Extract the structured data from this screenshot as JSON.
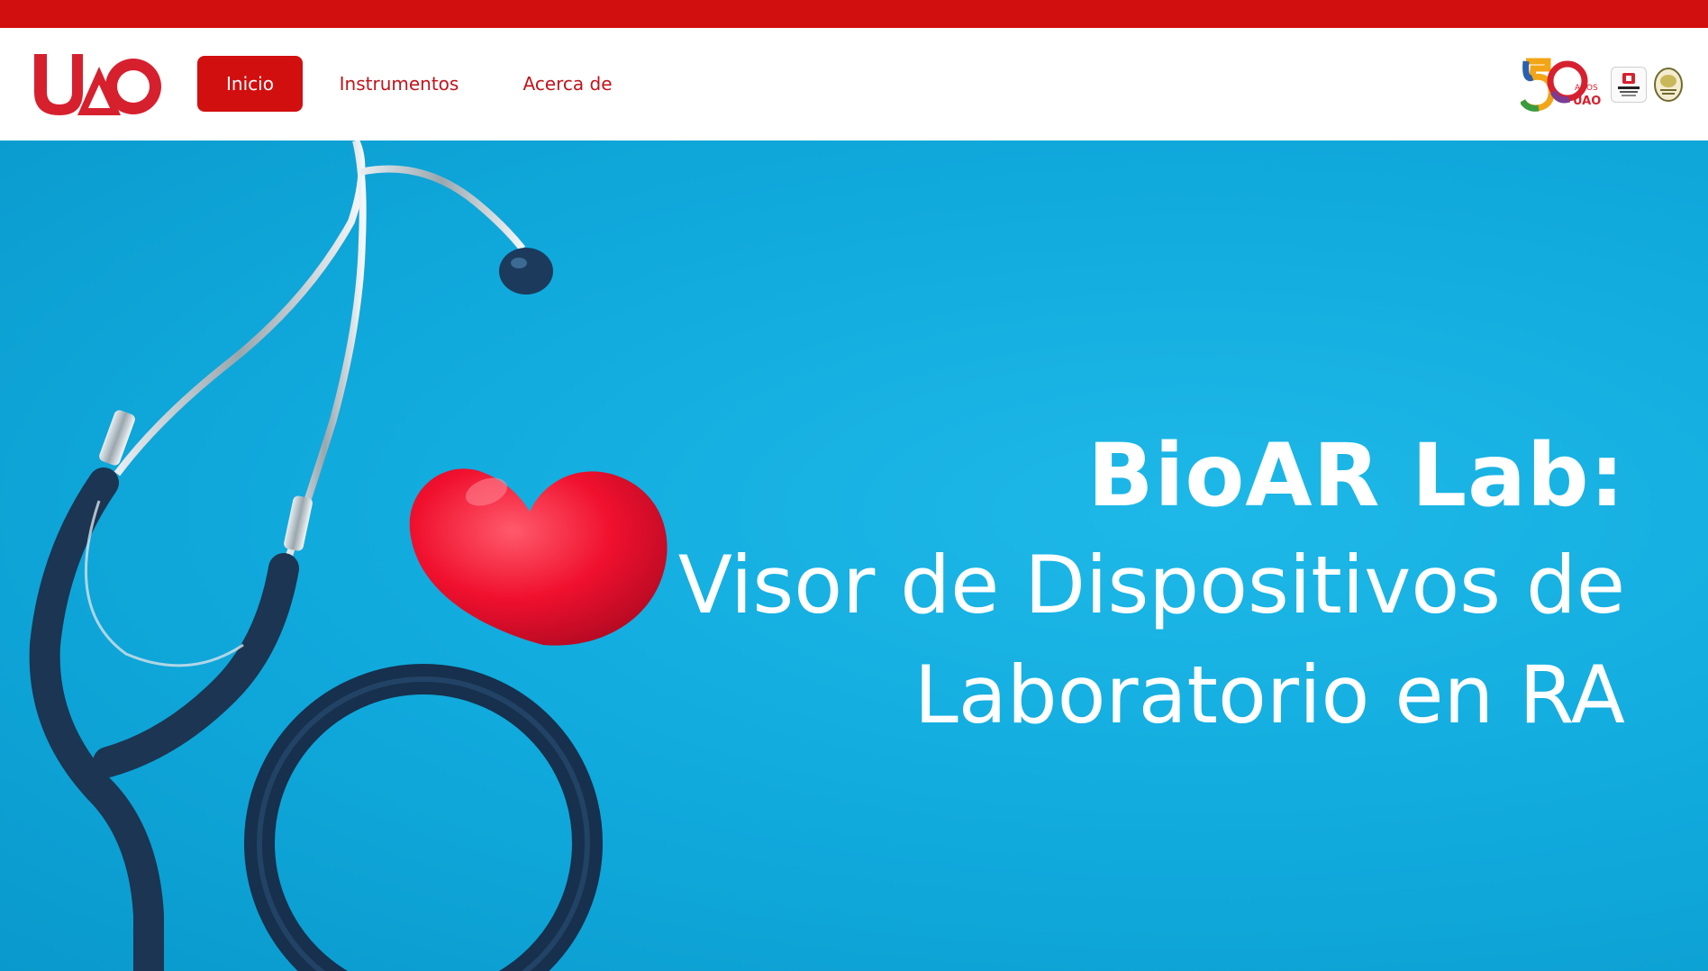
{
  "brand": {
    "logo_text": "UAO",
    "logo_color": "#d6202e"
  },
  "nav": {
    "items": [
      {
        "label": "Inicio",
        "active": true
      },
      {
        "label": "Instrumentos",
        "active": false
      },
      {
        "label": "Acerca de",
        "active": false
      }
    ],
    "accent_color": "#d20f0f"
  },
  "partners": {
    "anniversary_number": "50",
    "anniversary_text": "AÑOS",
    "anniversary_brand": "UAO",
    "seal_text": "AUTÓNOMA"
  },
  "hero": {
    "title_strong": "BioAR Lab:",
    "title_light": "Visor de Dispositivos de Laboratorio en RA",
    "background_color": "#10a9dc"
  },
  "icons": {
    "hero_left": "stethoscope-icon",
    "hero_heart": "heart-icon"
  }
}
